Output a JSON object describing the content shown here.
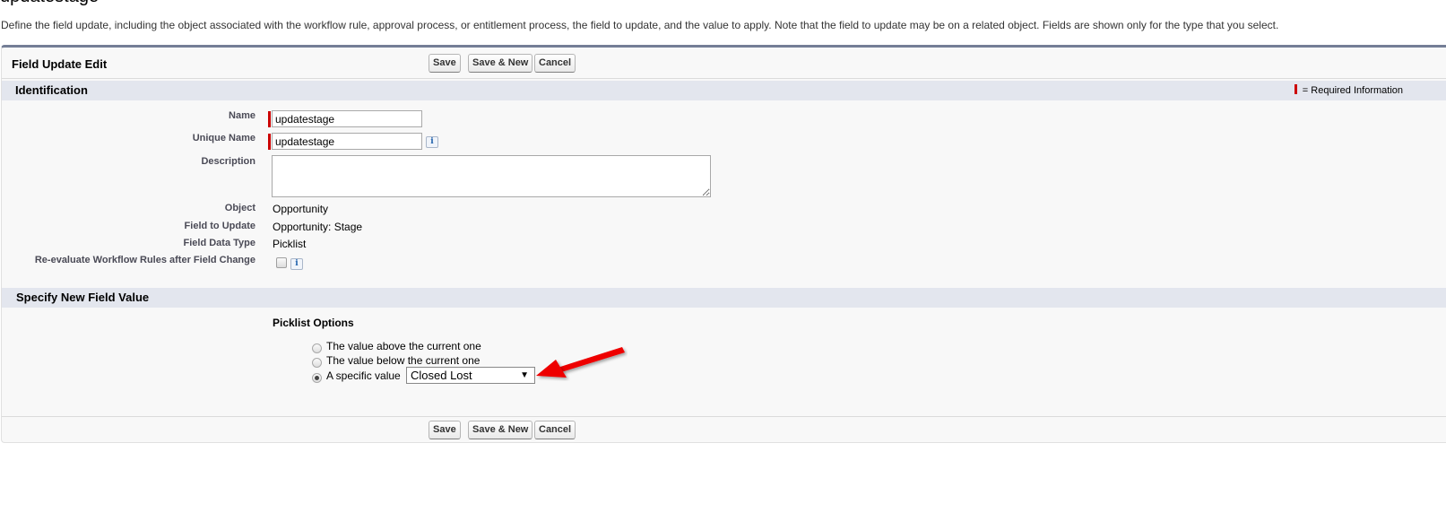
{
  "page": {
    "title": "updatestage",
    "intro": "Define the field update, including the object associated with the workflow rule, approval process, or entitlement process, the field to update, and the value to apply. Note that the field to update may be on a related object. Fields are shown only for the type that you select."
  },
  "panel": {
    "title": "Field Update Edit",
    "buttons": {
      "save": "Save",
      "save_new": "Save & New",
      "cancel": "Cancel"
    }
  },
  "identification": {
    "title": "Identification",
    "required_legend": "= Required Information",
    "fields": {
      "name": {
        "label": "Name",
        "value": "updatestage"
      },
      "unique_name": {
        "label": "Unique Name",
        "value": "updatestage"
      },
      "description": {
        "label": "Description",
        "value": ""
      },
      "object": {
        "label": "Object",
        "value": "Opportunity"
      },
      "field_to_update": {
        "label": "Field to Update",
        "value": "Opportunity: Stage"
      },
      "field_data_type": {
        "label": "Field Data Type",
        "value": "Picklist"
      },
      "reevaluate": {
        "label": "Re-evaluate Workflow Rules after Field Change",
        "checked": false
      }
    },
    "info_glyph": "i"
  },
  "new_value": {
    "title": "Specify New Field Value",
    "picklist_label": "Picklist Options",
    "options": [
      {
        "label": "The value above the current one",
        "selected": false
      },
      {
        "label": "The value below the current one",
        "selected": false
      },
      {
        "label": "A specific value",
        "selected": true
      }
    ],
    "specific_value": "Closed Lost",
    "caret": "▼"
  },
  "annotation": {
    "arrow_color": "#ee0000",
    "points_to": "specific-value-select"
  }
}
